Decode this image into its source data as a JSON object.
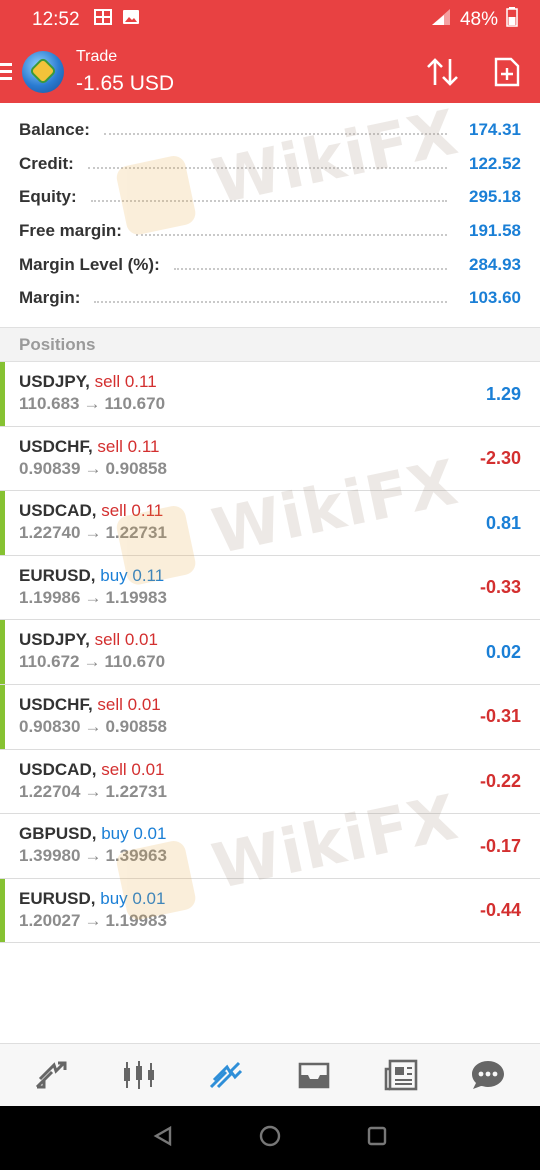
{
  "status_bar": {
    "time": "12:52",
    "battery": "48%"
  },
  "app_bar": {
    "title": "Trade",
    "subtitle": "-1.65 USD"
  },
  "summary": [
    {
      "label": "Balance:",
      "value": "174.31"
    },
    {
      "label": "Credit:",
      "value": "122.52"
    },
    {
      "label": "Equity:",
      "value": "295.18"
    },
    {
      "label": "Free margin:",
      "value": "191.58"
    },
    {
      "label": "Margin Level (%):",
      "value": "284.93"
    },
    {
      "label": "Margin:",
      "value": "103.60"
    }
  ],
  "positions_header": "Positions",
  "positions": [
    {
      "symbol": "USDJPY,",
      "side": "sell 0.11",
      "open": "110.683",
      "arrow": "→",
      "current": "110.670",
      "profit": "1.29"
    },
    {
      "symbol": "USDCHF,",
      "side": "sell 0.11",
      "open": "0.90839",
      "arrow": "→",
      "current": "0.90858",
      "profit": "-2.30"
    },
    {
      "symbol": "USDCAD,",
      "side": "sell 0.11",
      "open": "1.22740",
      "arrow": "→",
      "current": "1.22731",
      "profit": "0.81"
    },
    {
      "symbol": "EURUSD,",
      "side": "buy 0.11",
      "open": "1.19986",
      "arrow": "→",
      "current": "1.19983",
      "profit": "-0.33"
    },
    {
      "symbol": "USDJPY,",
      "side": "sell 0.01",
      "open": "110.672",
      "arrow": "→",
      "current": "110.670",
      "profit": "0.02"
    },
    {
      "symbol": "USDCHF,",
      "side": "sell 0.01",
      "open": "0.90830",
      "arrow": "→",
      "current": "0.90858",
      "profit": "-0.31"
    },
    {
      "symbol": "USDCAD,",
      "side": "sell 0.01",
      "open": "1.22704",
      "arrow": "→",
      "current": "1.22731",
      "profit": "-0.22"
    },
    {
      "symbol": "GBPUSD,",
      "side": "buy 0.01",
      "open": "1.39980",
      "arrow": "→",
      "current": "1.39963",
      "profit": "-0.17"
    },
    {
      "symbol": "EURUSD,",
      "side": "buy 0.01",
      "open": "1.20027",
      "arrow": "→",
      "current": "1.19983",
      "profit": "-0.44"
    }
  ],
  "watermark_text": "WikiFX",
  "bottom_nav": [
    "quotes-icon",
    "chart-icon",
    "trade-icon",
    "history-icon",
    "news-icon",
    "chat-icon"
  ],
  "colors": {
    "brand_red": "#e84142",
    "value_blue": "#1a7fd6",
    "loss_red": "#d32f2f",
    "accent_green": "#86c232"
  }
}
